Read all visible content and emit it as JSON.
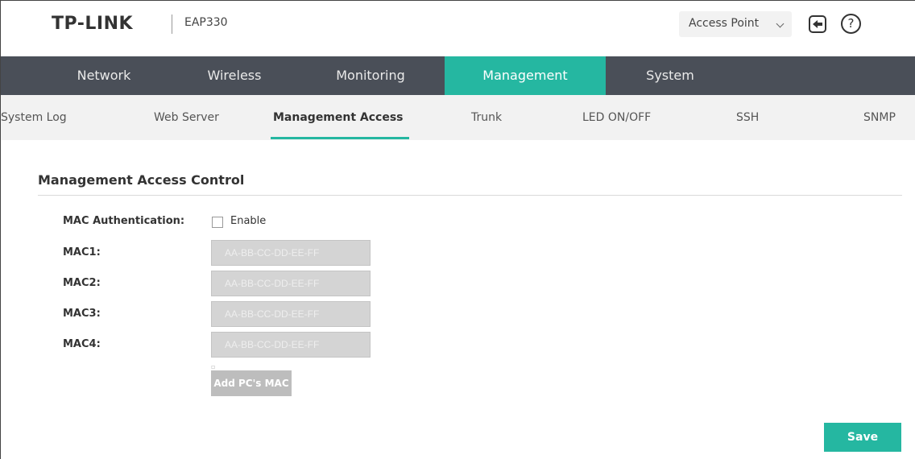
{
  "header": {
    "brand": "TP-LINK",
    "model": "EAP330",
    "mode_select": "Access Point",
    "icons": {
      "logout": "logout-icon",
      "help": "help-icon",
      "help_glyph": "?"
    }
  },
  "main_nav": {
    "tabs": [
      {
        "label": "Network",
        "active": false
      },
      {
        "label": "Wireless",
        "active": false
      },
      {
        "label": "Monitoring",
        "active": false
      },
      {
        "label": "Management",
        "active": true
      },
      {
        "label": "System",
        "active": false
      }
    ]
  },
  "sub_nav": {
    "tabs": [
      {
        "label": "System Log",
        "active": false
      },
      {
        "label": "Web Server",
        "active": false
      },
      {
        "label": "Management Access",
        "active": true
      },
      {
        "label": "Trunk",
        "active": false
      },
      {
        "label": "LED ON/OFF",
        "active": false
      },
      {
        "label": "SSH",
        "active": false
      },
      {
        "label": "SNMP",
        "active": false
      }
    ]
  },
  "content": {
    "section_title": "Management Access Control",
    "mac_auth_label": "MAC Authentication:",
    "enable_label": "Enable",
    "enable_checked": false,
    "mac_fields": [
      {
        "label": "MAC1:",
        "placeholder": "AA-BB-CC-DD-EE-FF",
        "value": ""
      },
      {
        "label": "MAC2:",
        "placeholder": "AA-BB-CC-DD-EE-FF",
        "value": ""
      },
      {
        "label": "MAC3:",
        "placeholder": "AA-BB-CC-DD-EE-FF",
        "value": ""
      },
      {
        "label": "MAC4:",
        "placeholder": "AA-BB-CC-DD-EE-FF",
        "value": ""
      }
    ],
    "add_pc_mac_button": "Add PC's MAC",
    "save_button": "Save"
  },
  "colors": {
    "accent": "#25b7a1",
    "nav_bg": "#4a4f58",
    "subnav_bg": "#f2f2f2",
    "disabled_input": "#d4d4d4"
  }
}
